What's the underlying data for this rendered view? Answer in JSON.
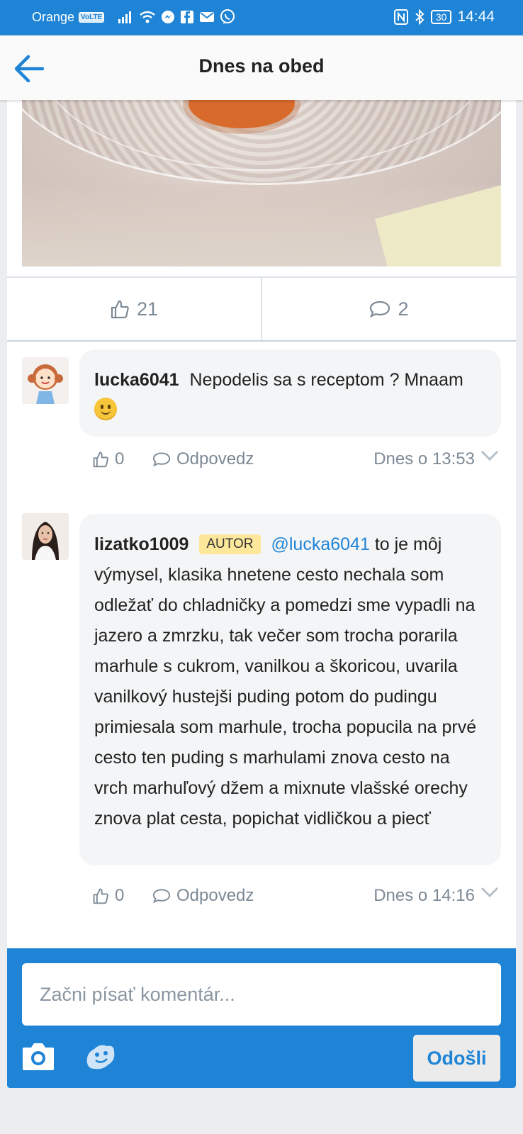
{
  "status_bar": {
    "carrier": "Orange",
    "network_badge": "VoLTE",
    "battery": "30",
    "time": "14:44"
  },
  "header": {
    "title": "Dnes na obed",
    "back_icon": "arrow-left-icon"
  },
  "post": {
    "likes": "21",
    "comments_count": "2"
  },
  "comments": [
    {
      "username": "lucka6041",
      "text": "Nepodelis sa s receptom ? Mnaam",
      "likes": "0",
      "reply_label": "Odpovedz",
      "time": "Dnes o 13:53"
    },
    {
      "username": "lizatko1009",
      "badge": "AUTOR",
      "mention": "@lucka6041",
      "text": "to je môj výmysel, klasika hnetene cesto nechala som odležať do chladničky a pomedzi sme vypadli na jazero a zmrzku, tak večer som trocha porarila marhule s cukrom, vanilkou a škoricou, uvarila vanilkový hustejši puding potom do pudingu primiesala som marhule, trocha popucila na prvé cesto ten puding s marhulami znova cesto na vrch marhuľový džem a mixnute vlašské orechy znova plat cesta, popichat vidličkou a piecť",
      "likes": "0",
      "reply_label": "Odpovedz",
      "time": "Dnes o 14:16"
    }
  ],
  "composer": {
    "placeholder": "Začni písať komentár...",
    "send_label": "Odošli"
  },
  "colors": {
    "brand_blue": "#1f84d6",
    "meta_gray": "#7d8a96",
    "badge_yellow": "#fde79a"
  }
}
